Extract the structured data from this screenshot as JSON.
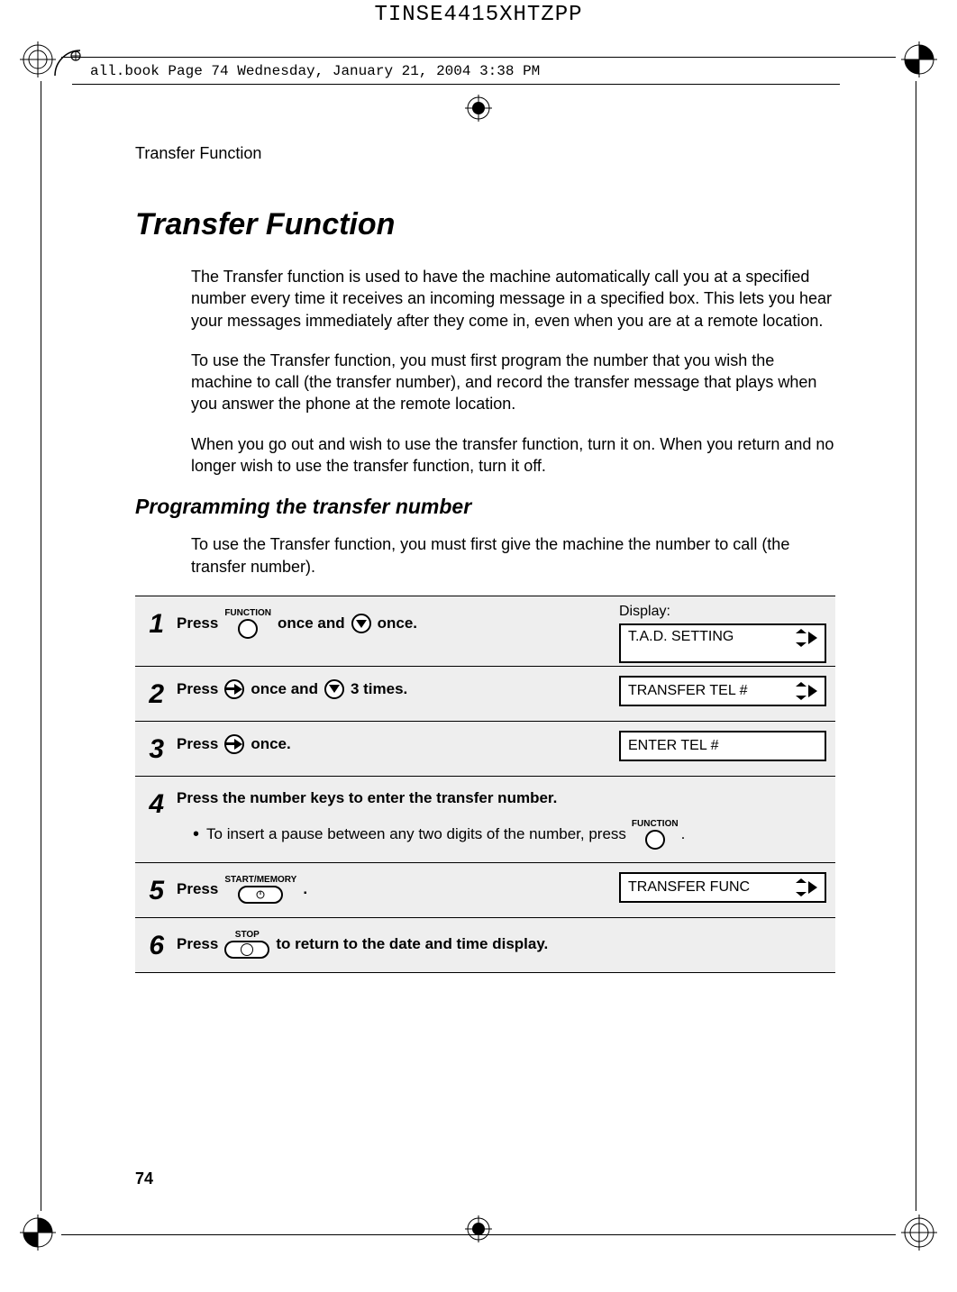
{
  "header_code": "TINSE4415XHTZPP",
  "book_info": "all.book  Page 74  Wednesday, January 21, 2004  3:38 PM",
  "running_header": "Transfer Function",
  "title": "Transfer Function",
  "para1": "The Transfer function is used to have the machine automatically call you at a specified number every time it receives an incoming message in a specified box. This lets you hear your messages immediately after they come in, even when you are at a remote location.",
  "para2": "To use the Transfer function, you must first program the number that you wish the machine to call (the transfer number), and record the transfer message that plays when you answer the phone at the remote location.",
  "para3": "When you go out and wish to use the transfer function, turn it on. When you return and no longer wish to use the transfer function, turn it off.",
  "subtitle": "Programming the transfer number",
  "para4": "To use the Transfer function, you must first give the machine the number to call (the transfer number).",
  "steps": {
    "display_label": "Display:",
    "s1": {
      "press": "Press",
      "function": "FUNCTION",
      "once_and": "once and",
      "once": "once.",
      "display": "T.A.D. SETTING"
    },
    "s2": {
      "press": "Press",
      "once_and": "once and",
      "three": "3 times.",
      "display": "TRANSFER TEL #"
    },
    "s3": {
      "press": "Press",
      "once": "once.",
      "display": "ENTER TEL #"
    },
    "s4": {
      "text": "Press the number keys to enter the transfer number.",
      "bullet": "To insert a pause between any two digits of the number, press",
      "function": "FUNCTION",
      "period": "."
    },
    "s5": {
      "press": "Press",
      "start": "START/MEMORY",
      "period": ".",
      "display": "TRANSFER FUNC"
    },
    "s6": {
      "press": "Press",
      "stop": "STOP",
      "rest": "to return to the date and time display."
    }
  },
  "page_num": "74",
  "chart_data": null
}
